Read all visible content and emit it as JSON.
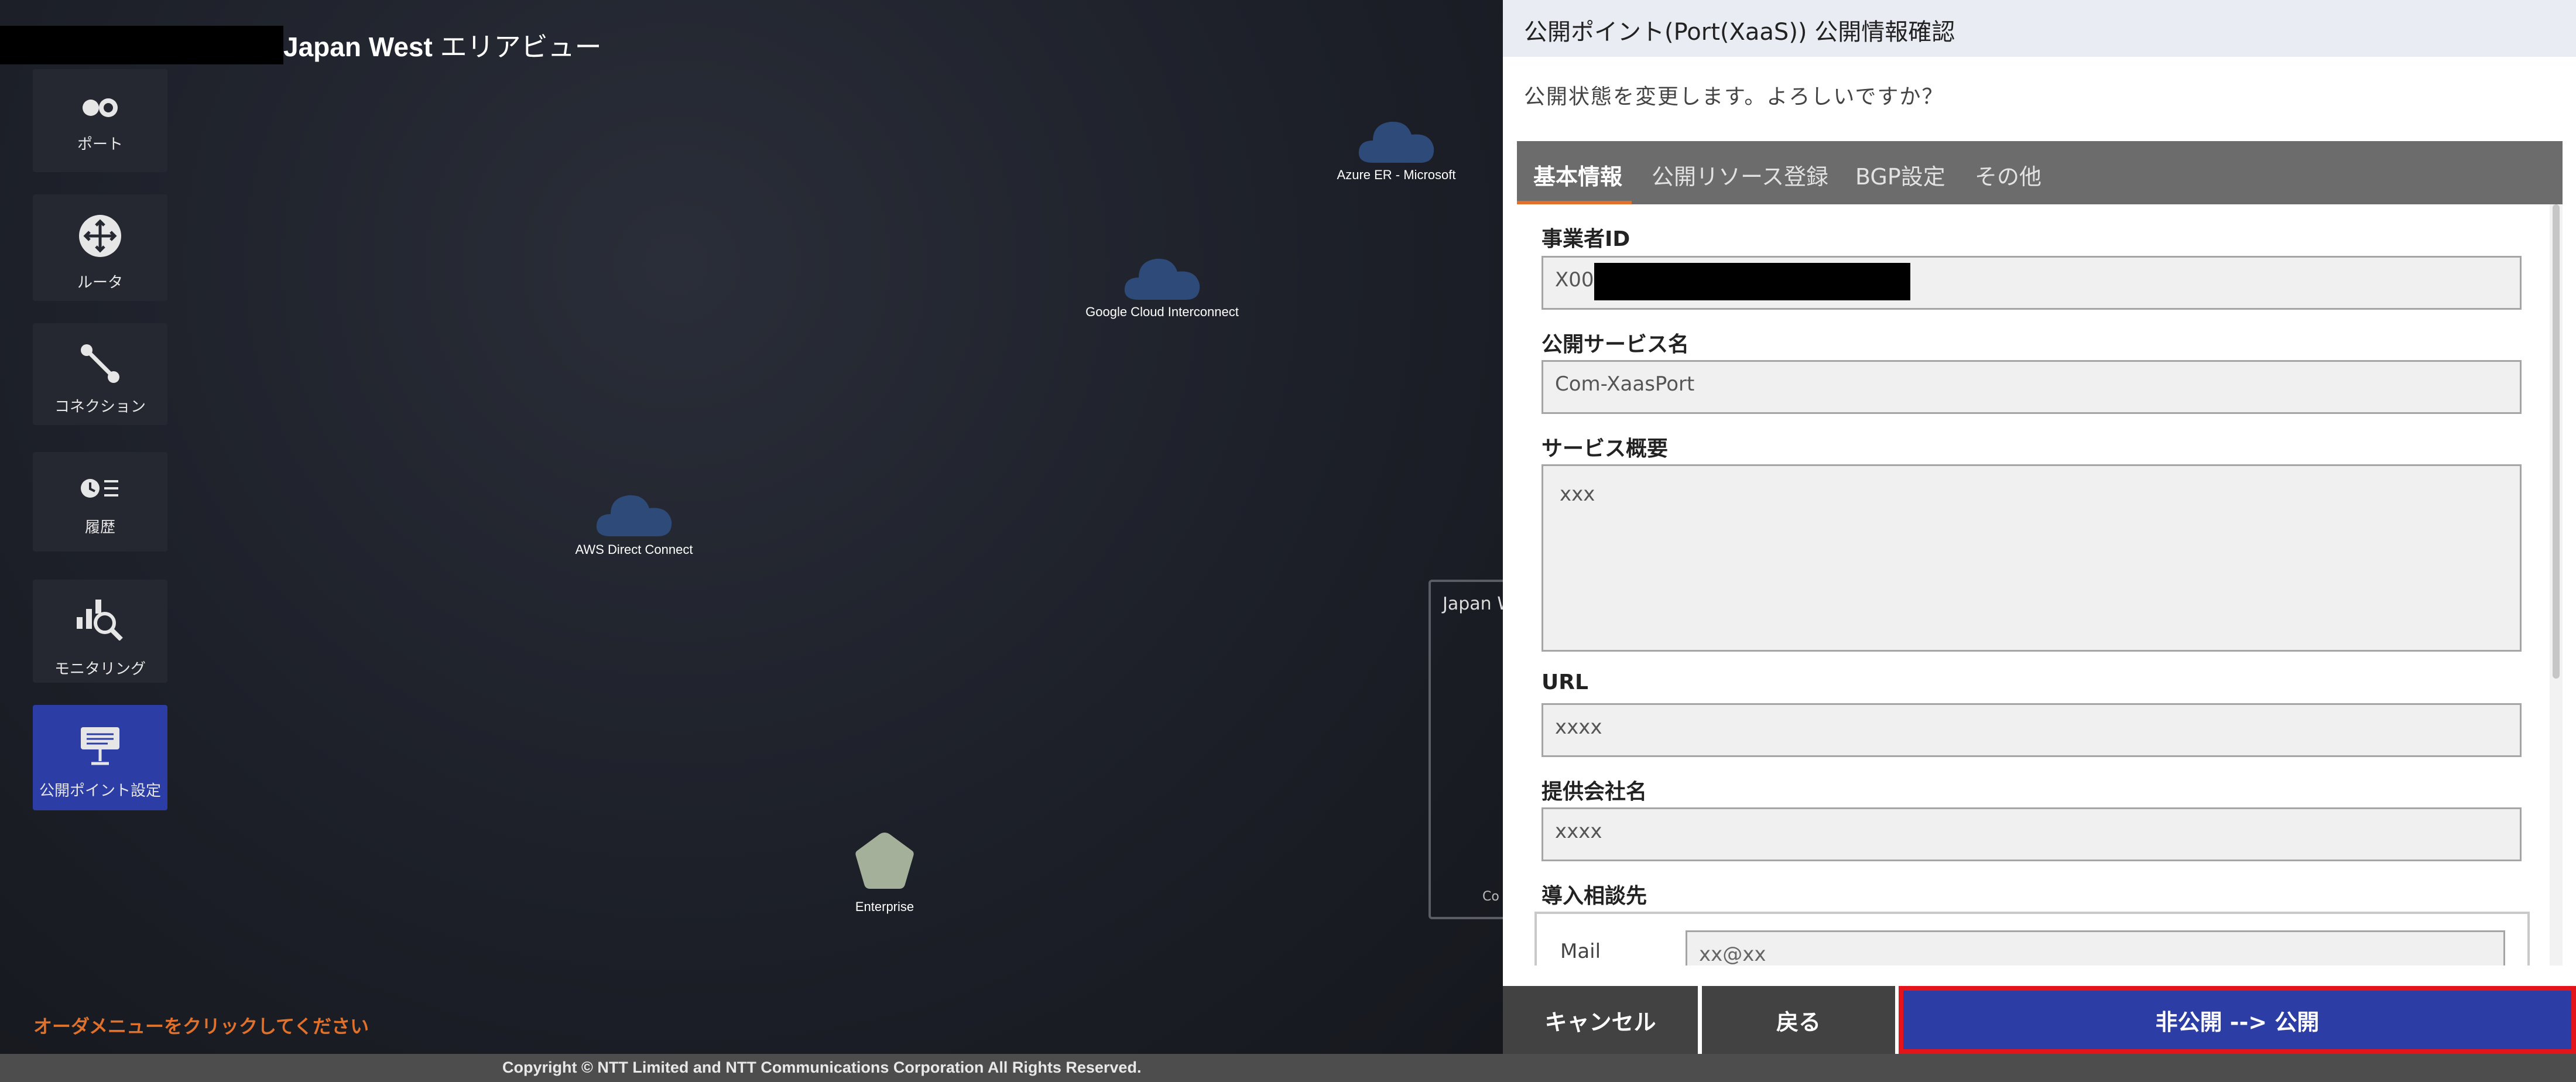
{
  "area": {
    "title": "Japan West",
    "title_suffix": " エリアビュー"
  },
  "sidebar": {
    "items": [
      {
        "label": "ポート",
        "icon": "toggle-icon"
      },
      {
        "label": "ルータ",
        "icon": "router-icon"
      },
      {
        "label": "コネクション",
        "icon": "connection-icon"
      },
      {
        "label": "履歴",
        "icon": "history-icon"
      },
      {
        "label": "モニタリング",
        "icon": "monitoring-icon"
      },
      {
        "label": "公開ポイント設定",
        "icon": "signboard-icon",
        "active": true
      }
    ]
  },
  "map": {
    "nodes": [
      {
        "label": "Azure ER - Microsoft",
        "icon": "cloud-icon"
      },
      {
        "label": "Google Cloud Interconnect",
        "icon": "cloud-icon"
      },
      {
        "label": "AWS Direct Connect",
        "icon": "cloud-icon"
      },
      {
        "label": "Enterprise",
        "icon": "pentagon-icon"
      }
    ],
    "region_box_title": "Japan W",
    "region_box_bottom": "Co",
    "order_message": "オーダメニューをクリックしてください"
  },
  "footer": {
    "copyright": "Copyright © NTT Limited and NTT Communications Corporation All Rights Reserved."
  },
  "dialog": {
    "title": "公開ポイント(Port(XaaS)) 公開情報確認",
    "message": "公開状態を変更します。よろしいですか？",
    "tabs": [
      "基本情報",
      "公開リソース登録",
      "BGP設定",
      "その他"
    ],
    "fields": {
      "operator_id": {
        "label": "事業者ID",
        "value": "X0020"
      },
      "service_name": {
        "label": "公開サービス名",
        "value": "Com-XaasPort"
      },
      "service_summary": {
        "label": "サービス概要",
        "value": "xxx"
      },
      "url": {
        "label": "URL",
        "value": "xxxx"
      },
      "provider": {
        "label": "提供会社名",
        "value": "xxxx"
      },
      "contact": {
        "label": "導入相談先",
        "mail_label": "Mail",
        "mail_value": "xx@xx"
      }
    },
    "buttons": {
      "cancel": "キャンセル",
      "back": "戻る",
      "publish": "非公開 --> 公開"
    },
    "colors": {
      "primary": "#2c3da5",
      "accent": "#e0702a",
      "highlight": "#e4141b"
    }
  }
}
